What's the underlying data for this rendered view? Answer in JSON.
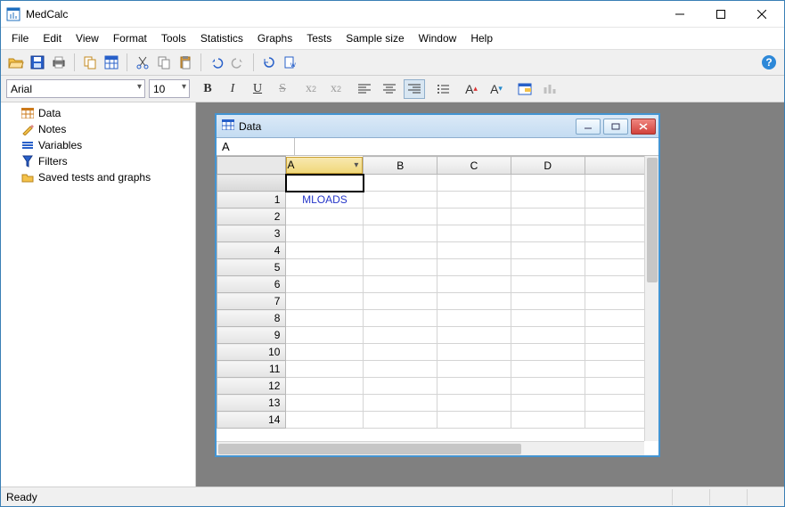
{
  "title": "MedCalc",
  "menu": [
    "File",
    "Edit",
    "View",
    "Format",
    "Tools",
    "Statistics",
    "Graphs",
    "Tests",
    "Sample size",
    "Window",
    "Help"
  ],
  "font": {
    "name": "Arial",
    "size": "10"
  },
  "tree": {
    "data": "Data",
    "notes": "Notes",
    "variables": "Variables",
    "filters": "Filters",
    "saved": "Saved tests and graphs"
  },
  "mdi": {
    "title": "Data",
    "cellref": "A",
    "cols": [
      "A",
      "B",
      "C",
      "D"
    ],
    "rows": [
      "1",
      "2",
      "3",
      "4",
      "5",
      "6",
      "7",
      "8",
      "9",
      "10",
      "11",
      "12",
      "13",
      "14"
    ],
    "cell_a1": "MLOADS"
  },
  "status": "Ready"
}
